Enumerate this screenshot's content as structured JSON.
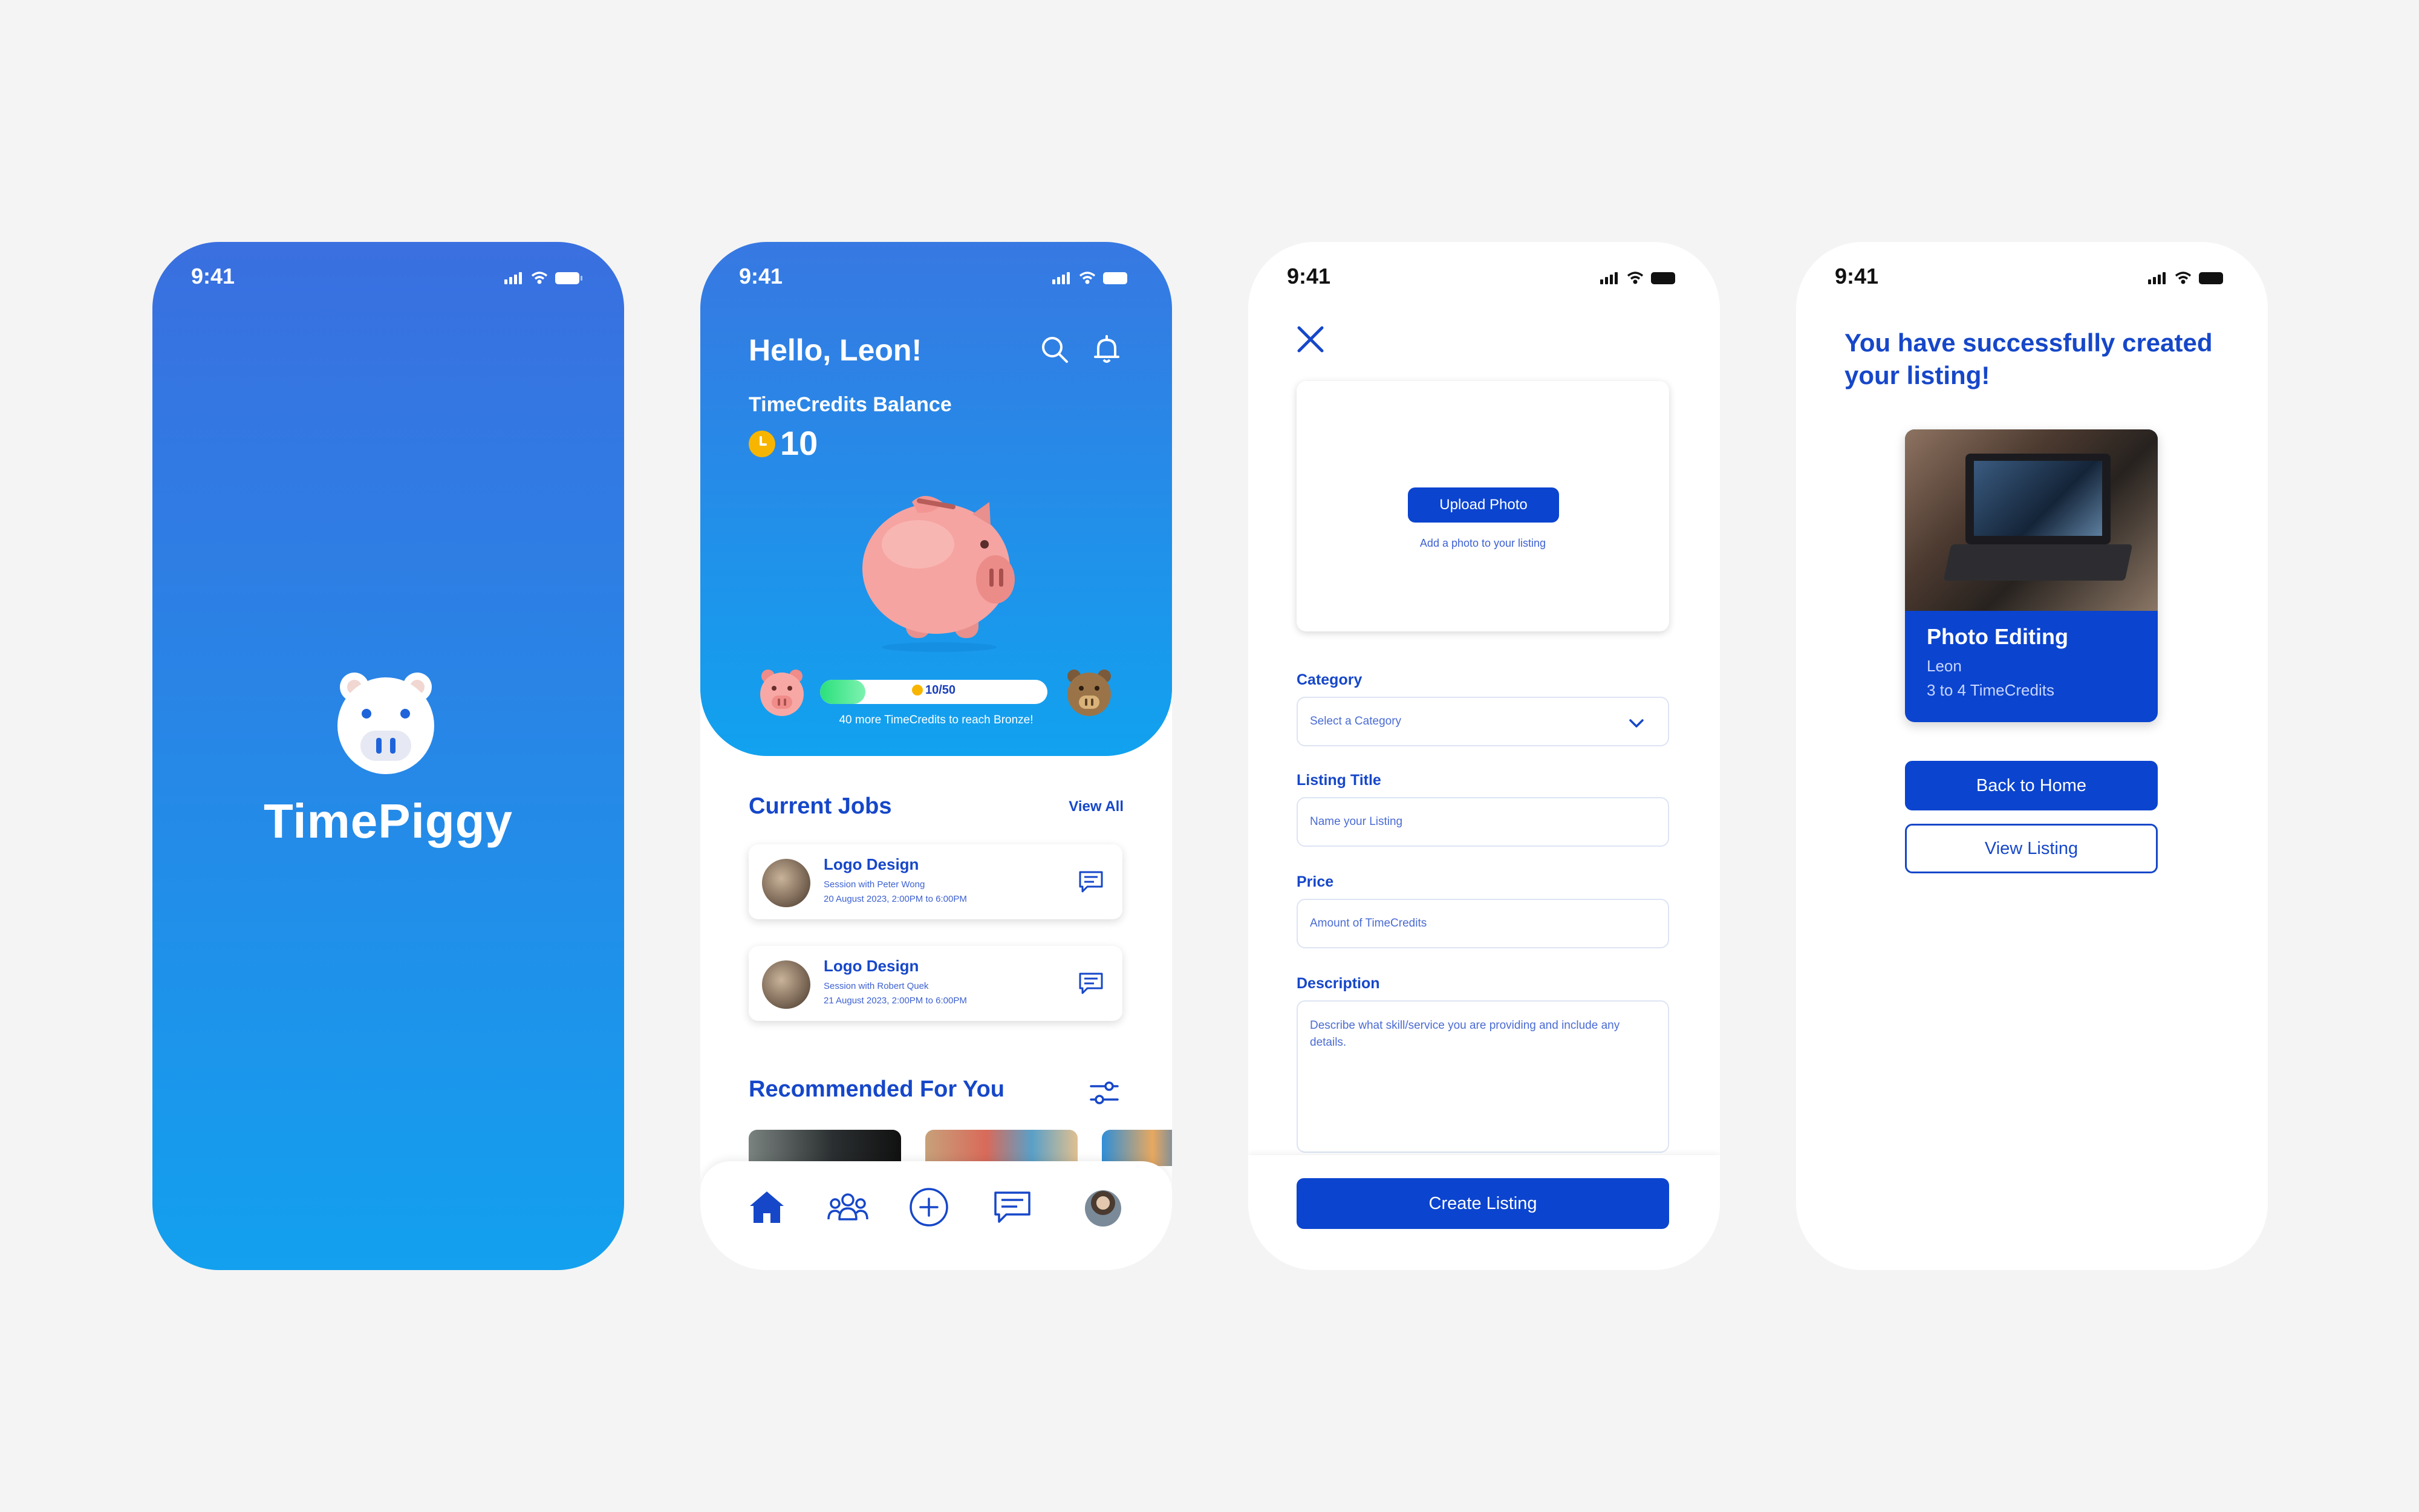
{
  "status_time": "9:41",
  "colors": {
    "primary": "#0b44cf",
    "heading": "#1647c9",
    "gradient_top": "#3a6fe0",
    "gradient_bottom": "#13a0ee",
    "page_bg": "#f4f4f4"
  },
  "splash": {
    "app_name": "TimePiggy",
    "logo_icon": "pig-face-icon"
  },
  "home": {
    "greeting": "Hello, Leon!",
    "balance_label": "TimeCredits Balance",
    "balance_value": "10",
    "progress": {
      "text": "10/50",
      "current": 10,
      "target": 50,
      "note": "40 more TimeCredits to reach Bronze!"
    },
    "current_jobs_title": "Current Jobs",
    "view_all": "View All",
    "jobs": [
      {
        "title": "Logo Design",
        "session": "Session with Peter Wong",
        "date": "20 August 2023, 2:00PM to 6:00PM"
      },
      {
        "title": "Logo Design",
        "session": "Session with Robert Quek",
        "date": "21 August 2023, 2:00PM to 6:00PM"
      }
    ],
    "recommended_title": "Recommended For You",
    "nav": [
      "home-icon",
      "community-icon",
      "add-icon",
      "chat-icon",
      "profile-avatar"
    ]
  },
  "create": {
    "upload_button": "Upload Photo",
    "upload_hint": "Add a photo to your listing",
    "category_label": "Category",
    "category_placeholder": "Select a Category",
    "title_label": "Listing Title",
    "title_placeholder": "Name your Listing",
    "price_label": "Price",
    "price_placeholder": "Amount of TimeCredits",
    "description_label": "Description",
    "description_placeholder": "Describe what skill/service you are providing and include any details.",
    "create_button": "Create Listing"
  },
  "success": {
    "message": "You have successfully created your listing!",
    "card_title": "Photo Editing",
    "card_owner": "Leon",
    "card_price": "3 to 4 TimeCredits",
    "back_button": "Back to Home",
    "view_button": "View Listing"
  }
}
